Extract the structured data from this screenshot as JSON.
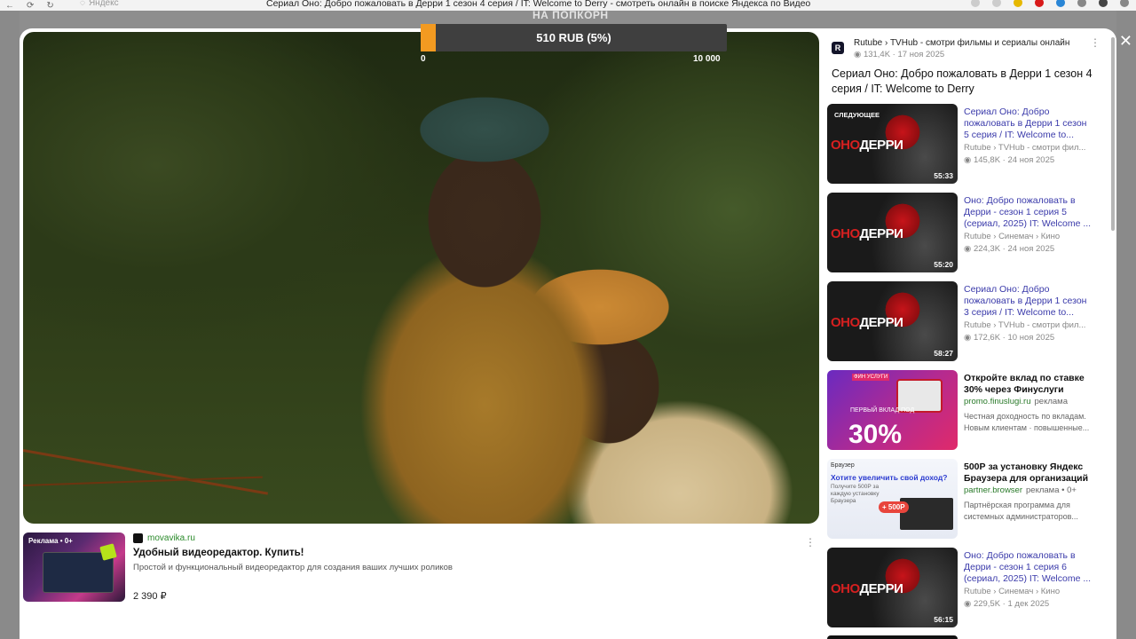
{
  "browser": {
    "address": "Яндекс",
    "page_title": "Сериал Оно: Добро пожаловать в Дерри 1 сезон 4 серия / IT: Welcome to Derry - смотреть онлайн в поиске Яндекса по Видео"
  },
  "player": {
    "watermark": "НА ПОПКОРН",
    "donation": {
      "label": "510 RUB (5%)",
      "min": "0",
      "max": "10 000",
      "progress": 0.05
    }
  },
  "ad": {
    "thumb_tag": "Реклама • 0+",
    "domain": "movavika.ru",
    "title": "Удобный видеоредактор. Купить!",
    "description": "Простой и функциональный видеоредактор для создания ваших лучших роликов",
    "price": "2 390 ₽"
  },
  "source": {
    "logo_letter": "R",
    "name": "Rutube › TVHub - смотри фильмы и сериалы онлайн",
    "meta": "131,4K · 17 ноя 2025",
    "title": "Сериал Оно: Добро пожаловать в Дерри 1 сезон 4 серия / IT: Welcome to Derry"
  },
  "recommendations": [
    {
      "title": "Сериал Оно: Добро пожаловать в Дерри 1 сезон 5 серия / IT: Welcome to...",
      "channel": "Rutube › TVHub - смотри фил...",
      "views": "145,8K · 24 ноя 2025",
      "duration": "55:33",
      "badge": "СЛЕДУЮЩЕЕ",
      "logo_red": "ОНО",
      "logo_white": "ДЕРРИ"
    },
    {
      "title": "Оно: Добро пожаловать в Дерри - сезон 1 серия 5 (сериал, 2025) IT: Welcome ...",
      "channel": "Rutube › Синемач › Кино",
      "views": "224,3K · 24 ноя 2025",
      "duration": "55:20",
      "badge": "",
      "logo_red": "ОНО",
      "logo_white": "ДЕРРИ"
    },
    {
      "title": "Сериал Оно: Добро пожаловать в Дерри 1 сезон 3 серия / IT: Welcome to...",
      "channel": "Rutube › TVHub - смотри фил...",
      "views": "172,6K · 10 ноя 2025",
      "duration": "58:27",
      "badge": "",
      "logo_red": "ОНО",
      "logo_white": "ДЕРРИ"
    }
  ],
  "promo1": {
    "title": "Откройте вклад по ставке 30% через Финуслуги",
    "domain": "promo.finuslugi.ru",
    "ad_mark": "реклама",
    "description": "Честная доходность по вкладам. Новым клиентам · повышенные...",
    "thumb_badge": "ФИН УСЛУГИ",
    "thumb_small": "ПЕРВЫЙ ВКЛАД ПОД",
    "thumb_big": "30%"
  },
  "promo2": {
    "title": "500Р за установку Яндекс Браузера для организаций",
    "domain": "partner.browser",
    "ad_mark": "реклама • 0+",
    "description": "Партнёрская программа для системных администраторов...",
    "thumb_header": "Браузер",
    "thumb_q": "Хотите увеличить свой доход?",
    "thumb_q2": "Получите 500Р за каждую установку Браузера",
    "thumb_badge": "+ 500Р"
  },
  "recommendation_last": {
    "title": "Оно: Добро пожаловать в Дерри - сезон 1 серия 6 (сериал, 2025) IT: Welcome ...",
    "channel": "Rutube › Синемач › Кино",
    "views": "229,5K · 1 дек 2025",
    "duration": "56:15",
    "logo_red": "ОНО",
    "logo_white": "ДЕРРИ"
  },
  "colors": {
    "accent_orange": "#f29a21",
    "link_blue": "#3a3aaa",
    "ad_green": "#2a8a2a"
  },
  "icons": [
    "back-arrow-icon",
    "forward-arrow-icon",
    "reload-icon",
    "shield-icon",
    "menu-more-icon",
    "close-icon",
    "views-eye-icon"
  ]
}
